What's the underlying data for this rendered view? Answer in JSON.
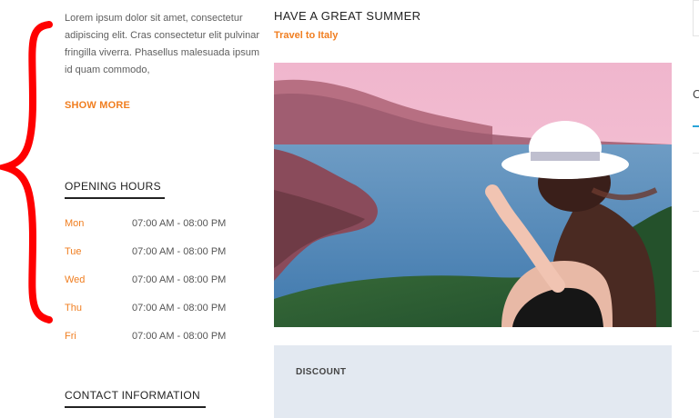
{
  "sidebar": {
    "intro_text": "Lorem ipsum dolor sit amet, consectetur adipiscing elit. Cras consectetur elit pulvinar fringilla viverra. Phasellus malesuada ipsum id quam commodo,",
    "show_more_label": "SHOW MORE",
    "opening_hours_title": "OPENING HOURS",
    "hours": [
      {
        "day": "Mon",
        "time": "07:00 AM - 08:00 PM"
      },
      {
        "day": "Tue",
        "time": "07:00 AM - 08:00 PM"
      },
      {
        "day": "Wed",
        "time": "07:00 AM - 08:00 PM"
      },
      {
        "day": "Thu",
        "time": "07:00 AM - 08:00 PM"
      },
      {
        "day": "Fri",
        "time": "07:00 AM - 08:00 PM"
      }
    ],
    "contact_title": "CONTACT INFORMATION"
  },
  "post": {
    "title": "HAVE A GREAT SUMMER",
    "category": "Travel to Italy",
    "discount_label": "DISCOUNT"
  },
  "right_panel": {
    "heading_fragment": "C"
  },
  "colors": {
    "accent": "#f07e20",
    "annotation": "#ff0000",
    "discount_bg": "#e3e9f1",
    "tab_accent": "#2aa4d8"
  }
}
